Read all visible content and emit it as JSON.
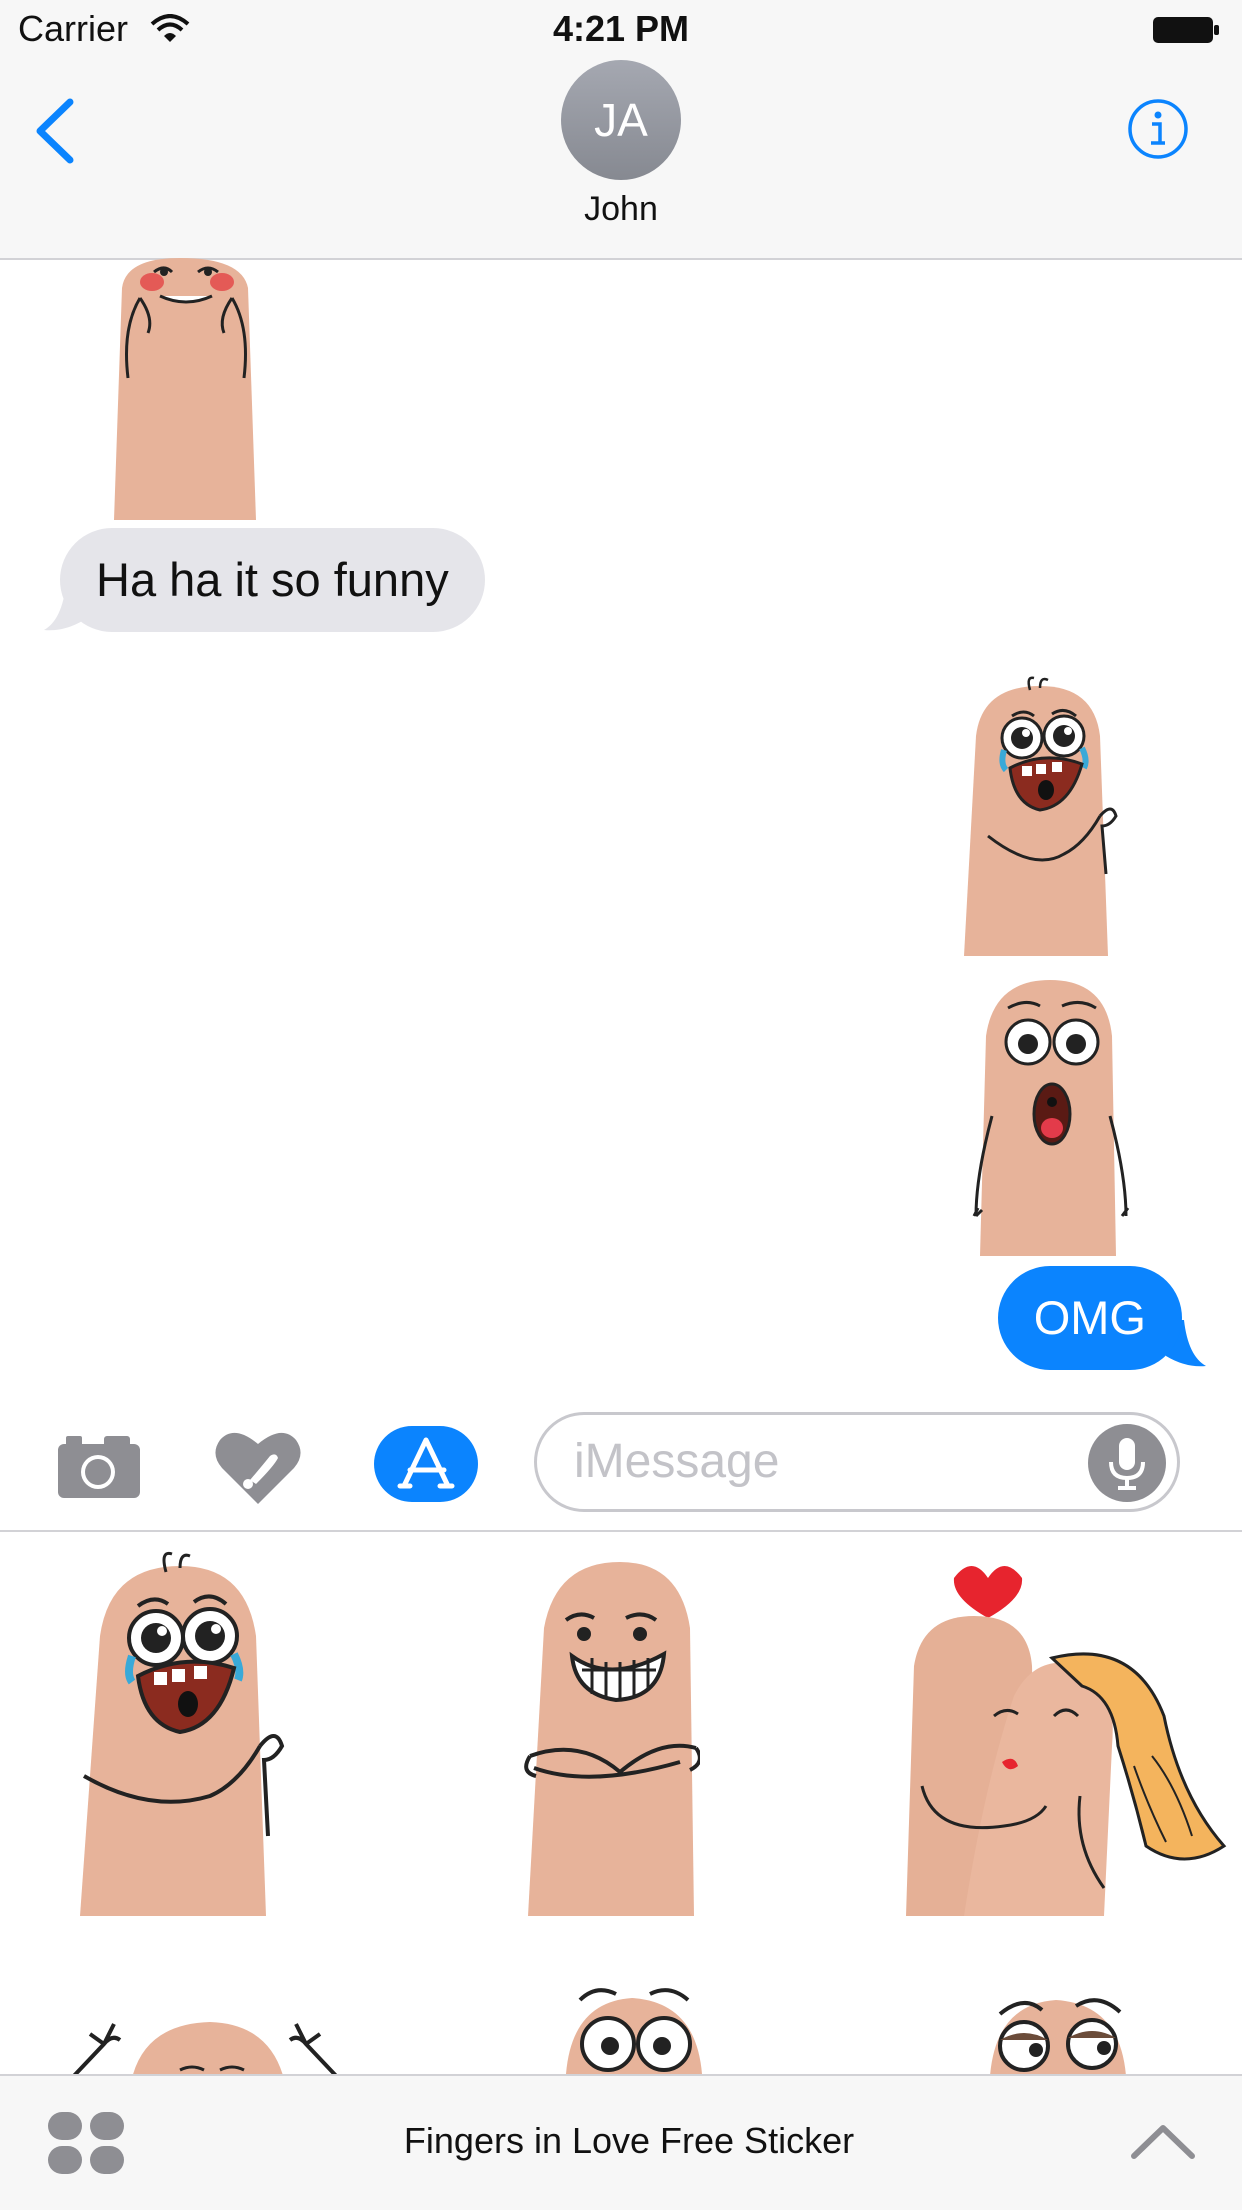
{
  "status_bar": {
    "carrier": "Carrier",
    "time": "4:21 PM"
  },
  "nav": {
    "avatar_initials": "JA",
    "contact_name": "John"
  },
  "messages": [
    {
      "type": "sticker",
      "direction": "incoming",
      "sticker": "finger-shy-blushing"
    },
    {
      "type": "text",
      "direction": "incoming",
      "text": "Ha ha it so funny"
    },
    {
      "type": "sticker",
      "direction": "outgoing",
      "sticker": "finger-crying-happy"
    },
    {
      "type": "sticker",
      "direction": "outgoing",
      "sticker": "finger-shocked"
    },
    {
      "type": "text",
      "direction": "outgoing",
      "text": "OMG"
    }
  ],
  "input": {
    "placeholder": "iMessage"
  },
  "drawer": {
    "stickers": [
      "finger-crying-happy",
      "finger-trollface-arms-crossed",
      "fingers-kissing-couple",
      "finger-arms-raised",
      "finger-wide-eyes",
      "finger-side-eye"
    ]
  },
  "bottom_bar": {
    "app_name": "Fingers in Love Free Sticker"
  },
  "colors": {
    "accent": "#0b84fe",
    "incoming_bubble": "#e5e5ea",
    "bar_bg": "#f7f7f7",
    "skin": "#e7b39a"
  }
}
